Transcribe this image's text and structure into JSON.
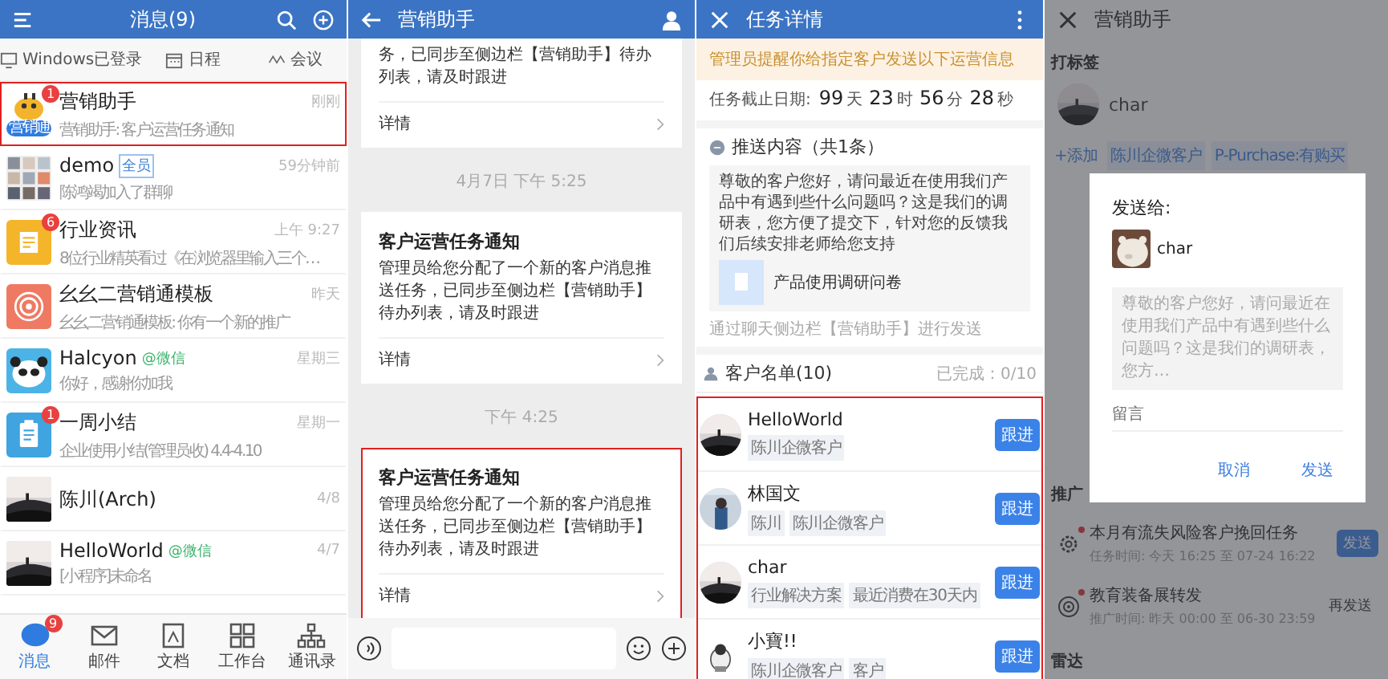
{
  "chat_list": {
    "title": "消息(9)",
    "subbar": [
      {
        "label": "Windows已登录"
      },
      {
        "label": "日程"
      },
      {
        "label": "会议"
      }
    ],
    "conversations": [
      {
        "name": "营销助手",
        "preview": "营销助手: 客户运营任务通知",
        "time": "刚刚",
        "badge": "1",
        "kind": "bot",
        "avatar_label": "营销通",
        "highlighted": true
      },
      {
        "name": "demo",
        "tag": {
          "text": "全员",
          "kind": "internal"
        },
        "preview": "陈鸿竭加入了群聊",
        "time": "59分钟前",
        "kind": "group",
        "highlighted": false
      },
      {
        "name": "行业资讯",
        "preview": "8位行业精英看过《在浏览器里输入三个…",
        "time": "上午 9:27",
        "badge": "6",
        "kind": "doc",
        "highlighted": false
      },
      {
        "name": "幺幺二营销通模板",
        "preview": "幺幺二营销通模板: 你有一个新的推广",
        "time": "昨天",
        "kind": "target",
        "highlighted": false
      },
      {
        "name": "Halcyon",
        "tag": {
          "text": "@微信",
          "kind": "wechat"
        },
        "preview": "你好，感谢你加我",
        "time": "星期三",
        "kind": "panda",
        "highlighted": false
      },
      {
        "name": "一周小结",
        "preview": "企业使用小结(管理员收) 4.4-4.10",
        "time": "星期一",
        "badge": "1",
        "kind": "clipboard",
        "highlighted": false
      },
      {
        "name": "陈川(Arch)",
        "time": "4/8",
        "highlighted": false
      },
      {
        "name": "HelloWorld",
        "tag": {
          "text": "@微信",
          "kind": "wechat"
        },
        "preview": "[小程序]未命名",
        "time": "4/7",
        "highlighted": false
      }
    ],
    "nav": [
      {
        "label": "消息",
        "badge": "9",
        "selected": true
      },
      {
        "label": "邮件",
        "selected": false
      },
      {
        "label": "文档",
        "selected": false
      },
      {
        "label": "工作台",
        "selected": false
      },
      {
        "label": "通讯录",
        "selected": false
      }
    ]
  },
  "chat": {
    "title": "营销助手",
    "items": [
      {
        "kind": "card",
        "body": "务，已同步至侧边栏【营销助手】待办列表，请及时跟进",
        "link": "详情",
        "highlighted": false
      },
      {
        "kind": "time",
        "text": "4月7日  下午 5:25"
      },
      {
        "kind": "card",
        "title": "客户运营任务通知",
        "body": "管理员给您分配了一个新的客户消息推送任务，已同步至侧边栏【营销助手】待办列表，请及时跟进",
        "link": "详情",
        "highlighted": false
      },
      {
        "kind": "time",
        "text": "下午 4:25"
      },
      {
        "kind": "card",
        "title": "客户运营任务通知",
        "body": "管理员给您分配了一个新的客户消息推送任务，已同步至侧边栏【营销助手】待办列表，请及时跟进",
        "link": "详情",
        "highlighted": true
      }
    ]
  },
  "task": {
    "title": "任务详情",
    "notice": "管理员提醒你给指定客户发送以下运营信息",
    "deadline_label": "任务截止日期:",
    "countdown": [
      {
        "value": "99",
        "unit": "天"
      },
      {
        "value": "23",
        "unit": "时"
      },
      {
        "value": "56",
        "unit": "分"
      },
      {
        "value": "28",
        "unit": "秒"
      }
    ],
    "push": {
      "heading": "推送内容（共1条）",
      "message": "尊敬的客户您好，请问最近在使用我们产品中有遇到些什么问题吗？这是我们的调研表，您方便了提交下，针对您的反馈我们后续安排老师给您支持",
      "attachment": "产品使用调研问卷",
      "footnote": "通过聊天侧边栏【营销助手】进行发送"
    },
    "customers": {
      "heading": "客户名单(10)",
      "progress": "已完成：0/10",
      "highlighted": true,
      "rows": [
        {
          "name": "HelloWorld",
          "tags": [
            "陈川企微客户"
          ],
          "action": "跟进"
        },
        {
          "name": "林国文",
          "kind": "person",
          "tags": [
            "陈川",
            "陈川企微客户"
          ],
          "action": "跟进"
        },
        {
          "name": "char",
          "tags": [
            "行业解决方案",
            "最近消费在30天内"
          ],
          "action": "跟进"
        },
        {
          "name": "小寶!!",
          "kind": "cartoon",
          "tags": [
            "陈川企微客户",
            "客户"
          ],
          "action": "跟进"
        }
      ]
    }
  },
  "sidebar": {
    "title": "营销助手",
    "tag_heading": "打标签",
    "contact": "char",
    "tags": [
      {
        "text": "+添加",
        "kind": "add"
      },
      {
        "text": "陈川企微客户",
        "kind": "tag"
      },
      {
        "text": "P-Purchase:有购买",
        "kind": "tag"
      }
    ],
    "promo_heading": "推广",
    "tasks": [
      {
        "title": "本月有流失风险客户挽回任务",
        "meta": "任务时间: 今天 16:25 至 07-24 16:22",
        "action": "发送",
        "kind": "primary",
        "unread": true
      },
      {
        "title": "教育装备展转发",
        "meta": "推广时间: 昨天 00:00 至 06-30 23:59",
        "action": "再发送",
        "kind": "plain",
        "unread": true
      }
    ],
    "radar_heading": "雷达",
    "dialog": {
      "title": "发送给:",
      "recipient": "char",
      "message": "尊敬的客户您好，请问最近在使用我们产品中有遇到些什么问题吗？这是我们的调研表，您方…",
      "placeholder": "留言",
      "buttons": [
        {
          "label": "取消"
        },
        {
          "label": "发送"
        }
      ]
    }
  }
}
